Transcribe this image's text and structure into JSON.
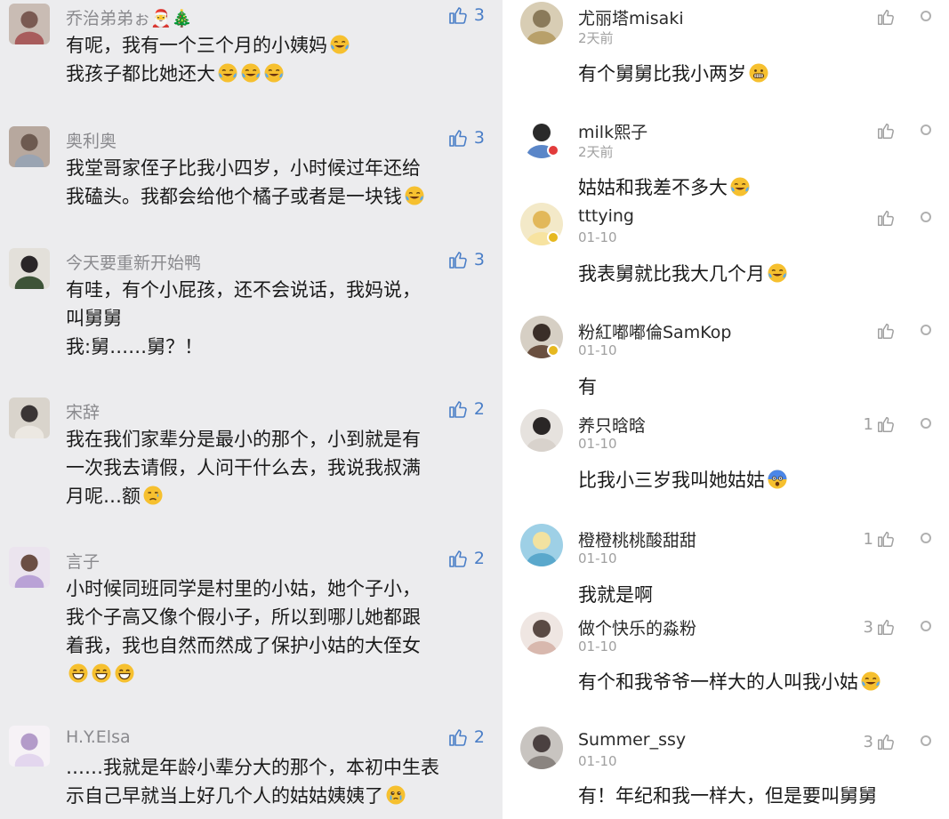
{
  "left_comments": [
    {
      "name": "乔治弟弟ぉ🎅🎄",
      "likes": "3",
      "lines": [
        "有呢，我有一个三个月的小姨妈",
        "我孩子都比她还大"
      ]
    },
    {
      "name": "奥利奥",
      "likes": "3",
      "lines": [
        "我堂哥家侄子比我小四岁，小时候过年还给",
        "我磕头。我都会给他个橘子或者是一块钱"
      ]
    },
    {
      "name": "今天要重新开始鸭",
      "likes": "3",
      "lines": [
        "有哇，有个小屁孩，还不会说话，我妈说，",
        "叫舅舅",
        "我:舅……舅？！"
      ]
    },
    {
      "name": "宋辞",
      "likes": "2",
      "lines": [
        "我在我们家辈分是最小的那个，小到就是有",
        "一次我去请假，人问干什么去，我说我叔满",
        "月呢…额"
      ]
    },
    {
      "name": "言子",
      "likes": "2",
      "lines": [
        "小时候同班同学是村里的小姑，她个子小，",
        "我个子高又像个假小子，所以到哪儿她都跟",
        "着我，我也自然而然成了保护小姑的大侄女",
        ""
      ]
    },
    {
      "name": "H.Y.Elsa",
      "likes": "2",
      "lines": [
        "……我就是年龄小辈分大的那个，本初中生表",
        "示自己早就当上好几个人的姑姑姨姨了"
      ]
    }
  ],
  "right_comments": [
    {
      "name": "尤丽塔misaki",
      "date": "2天前",
      "likes": "",
      "text": "有个舅舅比我小两岁"
    },
    {
      "name": "milk熙子",
      "date": "2天前",
      "likes": "",
      "text": "姑姑和我差不多大"
    },
    {
      "name": "tttying",
      "date": "01-10",
      "likes": "",
      "text": "我表舅就比我大几个月"
    },
    {
      "name": "粉紅嘟嘟倫SamKop",
      "date": "01-10",
      "likes": "",
      "text": "有"
    },
    {
      "name": "养只晗晗",
      "date": "01-10",
      "likes": "1",
      "text": "比我小三岁我叫她姑姑"
    },
    {
      "name": "橙橙桃桃酸甜甜",
      "date": "01-10",
      "likes": "1",
      "text": "我就是啊"
    },
    {
      "name": "做个快乐的淼粉",
      "date": "01-10",
      "likes": "3",
      "text": "有个和我爷爷一样大的人叫我小姑"
    },
    {
      "name": "Summer_ssy",
      "date": "01-10",
      "likes": "3",
      "text": "有！年纪和我一样大，但是要叫舅舅"
    }
  ],
  "icons": {
    "left_like": "thumbs-up-outline-icon",
    "right_like": "thumbs-up-outline-icon",
    "more": "circle-dot-icon",
    "emoji_laugh_cry": "laugh-cry-emoji-icon",
    "emoji_tears": "tears-of-joy-emoji-icon",
    "emoji_sad": "sad-emoji-icon",
    "emoji_grin": "grin-emoji-icon",
    "emoji_teary": "teary-emoji-icon",
    "emoji_grimace": "grimace-emoji-icon",
    "emoji_shock": "shock-emoji-icon"
  },
  "colors": {
    "left_bg": "#ececee",
    "left_like": "#4a7ec7",
    "right_like": "#a0a0a0",
    "badge_red": "#e23b3b",
    "badge_gold": "#e6b81f"
  }
}
